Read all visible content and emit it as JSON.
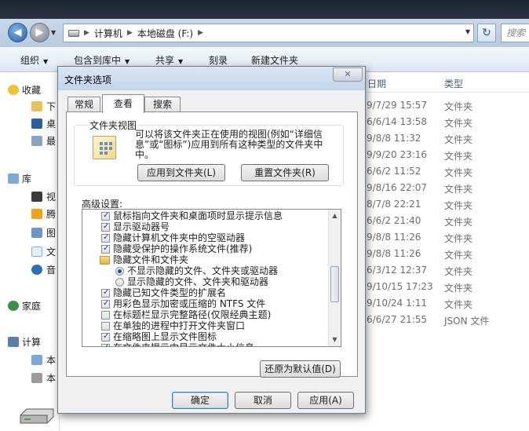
{
  "explorer": {
    "address": {
      "segments": [
        "计算机",
        "本地磁盘 (F:)"
      ]
    },
    "search_placeholder": "搜索",
    "toolbar": {
      "organize": "组织",
      "include_in_library": "包含到库中",
      "share": "共享",
      "burn": "刻录",
      "new_folder": "新建文件夹"
    },
    "nav": {
      "favorites": "收藏",
      "fav_items": [
        "下",
        "桌",
        "最"
      ],
      "libraries": "库",
      "lib_items": [
        "视",
        "腾",
        "图",
        "文",
        "音"
      ],
      "homegroup": "家庭",
      "computer": "计算",
      "computer_items": [
        "本",
        "本"
      ]
    },
    "columns": {
      "date": "日期",
      "type": "类型"
    },
    "rows": [
      {
        "date": "9/7/29 15:57",
        "type": "文件夹"
      },
      {
        "date": "6/6/14 13:58",
        "type": "文件夹"
      },
      {
        "date": "9/8/8 11:32",
        "type": "文件夹"
      },
      {
        "date": "9/9/20 23:16",
        "type": "文件夹"
      },
      {
        "date": "6/6/2 11:52",
        "type": "文件夹"
      },
      {
        "date": "9/8/16 22:07",
        "type": "文件夹"
      },
      {
        "date": "8/7/8 22:21",
        "type": "文件夹"
      },
      {
        "date": "6/6/2 21:40",
        "type": "文件夹"
      },
      {
        "date": "9/8/8 11:26",
        "type": "文件夹"
      },
      {
        "date": "9/8/8 11:26",
        "type": "文件夹"
      },
      {
        "date": "6/3/12 12:37",
        "type": "文件夹"
      },
      {
        "date": "9/10/15 17:23",
        "type": "文件夹"
      },
      {
        "date": "9/10/24 1:11",
        "type": "文件夹"
      },
      {
        "date": "6/6/27 21:55",
        "type": "JSON 文件"
      }
    ]
  },
  "dialog": {
    "title": "文件夹选项",
    "tabs": [
      "常规",
      "查看",
      "搜索"
    ],
    "active_tab": "查看",
    "folder_view": {
      "title": "文件夹视图",
      "desc_line1": "可以将该文件夹正在使用的视图(例如“详细信",
      "desc_line2": "息”或“图标”)应用到所有这种类型的文件夹中",
      "desc_line3": "中。",
      "apply_btn": "应用到文件夹(L)",
      "reset_btn": "重置文件夹(R)"
    },
    "advanced_label": "高级设置:",
    "settings": [
      {
        "kind": "checkbox",
        "checked": true,
        "label": "鼠标指向文件夹和桌面项时显示提示信息"
      },
      {
        "kind": "checkbox",
        "checked": true,
        "label": "显示驱动器号"
      },
      {
        "kind": "checkbox",
        "checked": true,
        "label": "隐藏计算机文件夹中的空驱动器"
      },
      {
        "kind": "checkbox",
        "checked": true,
        "label": "隐藏受保护的操作系统文件(推荐)"
      },
      {
        "kind": "folder",
        "checked": false,
        "label": "隐藏文件和文件夹"
      },
      {
        "kind": "radio",
        "checked": true,
        "label": "不显示隐藏的文件、文件夹或驱动器"
      },
      {
        "kind": "radio",
        "checked": false,
        "label": "显示隐藏的文件、文件夹和驱动器"
      },
      {
        "kind": "checkbox",
        "checked": true,
        "label": "隐藏已知文件类型的扩展名"
      },
      {
        "kind": "checkbox",
        "checked": true,
        "label": "用彩色显示加密或压缩的 NTFS 文件"
      },
      {
        "kind": "checkbox",
        "checked": false,
        "label": "在标题栏显示完整路径(仅限经典主题)"
      },
      {
        "kind": "checkbox",
        "checked": false,
        "label": "在单独的进程中打开文件夹窗口"
      },
      {
        "kind": "checkbox",
        "checked": true,
        "label": "在缩略图上显示文件图标"
      },
      {
        "kind": "checkbox",
        "checked": true,
        "label": "在文件夹提示中显示文件大小信息"
      }
    ],
    "restore_defaults": "还原为默认值(D)",
    "ok": "确定",
    "cancel": "取消",
    "apply": "应用(A)"
  }
}
